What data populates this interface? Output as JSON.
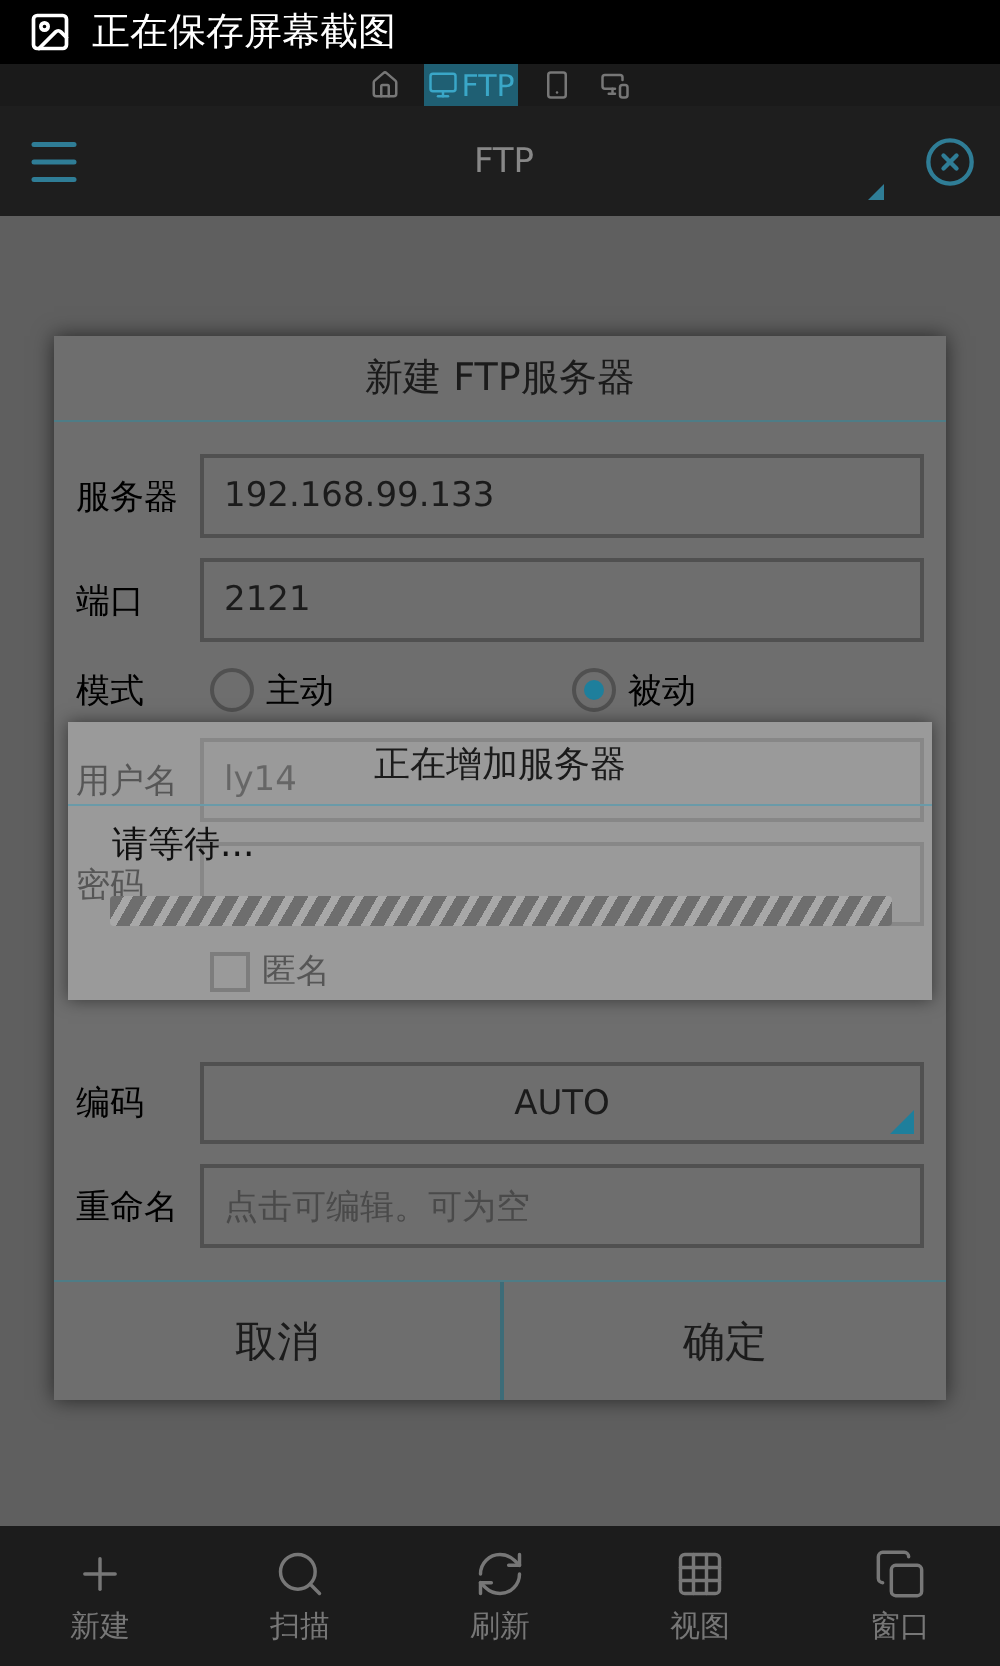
{
  "status_bar": {
    "notification": "正在保存屏幕截图"
  },
  "nav_tabs": [
    {
      "kind": "home",
      "selected": false
    },
    {
      "kind": "ftp",
      "label": "FTP",
      "selected": true
    },
    {
      "kind": "phone",
      "selected": false
    },
    {
      "kind": "devices",
      "selected": false
    }
  ],
  "app_bar": {
    "title": "FTP"
  },
  "dialog": {
    "title": "新建 FTP服务器",
    "rows": [
      {
        "kind": "text",
        "label": "服务器",
        "value": "192.168.99.133"
      },
      {
        "kind": "text",
        "label": "端口",
        "value": "2121"
      },
      {
        "kind": "radio",
        "label": "模式",
        "options": [
          {
            "label": "主动",
            "selected": false
          },
          {
            "label": "被动",
            "selected": true
          }
        ]
      },
      {
        "kind": "text",
        "label": "用户名",
        "value": "ly14"
      },
      {
        "kind": "text",
        "label": "密码"
      },
      {
        "kind": "checkbox",
        "label": "匿名",
        "checked": false
      },
      {
        "kind": "select",
        "label": "编码",
        "value": "AUTO"
      },
      {
        "kind": "text",
        "label": "重命名",
        "placeholder": "点击可编辑。可为空"
      }
    ],
    "buttons": [
      "取消",
      "确定"
    ]
  },
  "progress": {
    "title": "正在增加服务器",
    "message": "请等待...",
    "indeterminate": true
  },
  "toolbar": [
    {
      "kind": "plus",
      "label": "新建"
    },
    {
      "kind": "search",
      "label": "扫描"
    },
    {
      "kind": "refresh",
      "label": "刷新"
    },
    {
      "kind": "grid",
      "label": "视图"
    },
    {
      "kind": "windows",
      "label": "窗口"
    }
  ]
}
